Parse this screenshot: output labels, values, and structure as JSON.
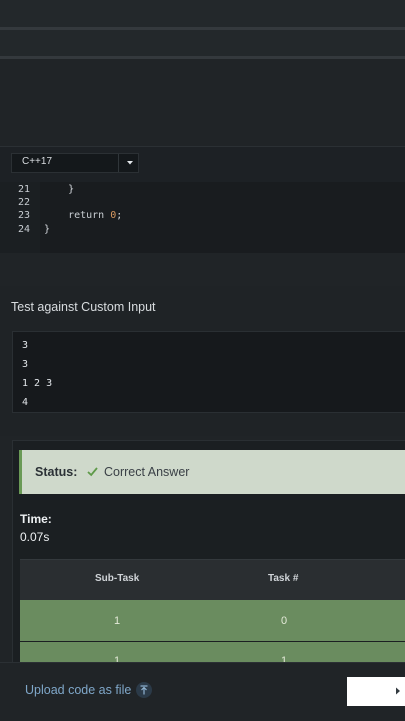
{
  "editor": {
    "language": "C++17",
    "lines": [
      {
        "number": "21",
        "code": "    }"
      },
      {
        "number": "22",
        "code": ""
      },
      {
        "number": "23",
        "keyword": "    return ",
        "value": "0",
        "tail": ";"
      },
      {
        "number": "24",
        "code": "}"
      }
    ]
  },
  "custom_input": {
    "title": "Test against Custom Input",
    "lines": [
      "3",
      "3",
      "1 2 3",
      "4"
    ]
  },
  "result": {
    "status_label": "Status:",
    "status_value": "Correct Answer",
    "status_icon": "check-icon",
    "time_label": "Time:",
    "time_value": "0.07s",
    "table": {
      "headers": [
        "Sub-Task",
        "Task #"
      ],
      "rows": [
        [
          "1",
          "0"
        ],
        [
          "1",
          "1"
        ]
      ]
    },
    "colors": {
      "success": "#6a8c5f",
      "status_bg": "#cfd9cb"
    }
  },
  "footer": {
    "upload_label": "Upload code as file",
    "upload_icon": "upload-icon",
    "submit_icon": "chevron-right-icon"
  }
}
